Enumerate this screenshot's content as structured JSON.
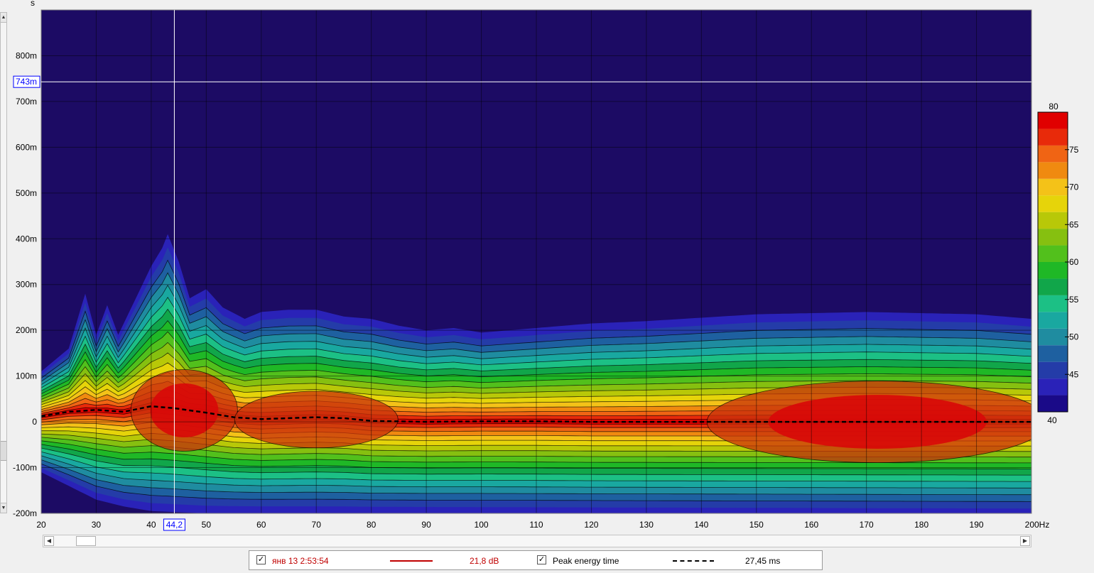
{
  "y_axis_unit": "s",
  "cursor": {
    "freq_label": "44,2",
    "time_label": "743m",
    "freq": 44.2,
    "time_ms": 743
  },
  "chart_data": {
    "type": "heatmap",
    "title": "",
    "x": {
      "min": 20,
      "max": 200,
      "unit": "Hz",
      "ticks": [
        20,
        30,
        40,
        50,
        60,
        70,
        80,
        90,
        100,
        110,
        120,
        130,
        140,
        150,
        160,
        170,
        180,
        190,
        200
      ],
      "tick_labels": [
        "20",
        "30",
        "40",
        "50",
        "60",
        "70",
        "80",
        "90",
        "100",
        "110",
        "120",
        "130",
        "140",
        "150",
        "160",
        "170",
        "180",
        "190",
        "200Hz"
      ]
    },
    "y": {
      "min_ms": -200,
      "max_ms": 900,
      "ticks_ms": [
        800,
        700,
        600,
        500,
        400,
        300,
        200,
        100,
        0,
        -100,
        -200
      ],
      "tick_labels": [
        "800m",
        "700m",
        "600m",
        "500m",
        "400m",
        "300m",
        "200m",
        "100m",
        "0",
        "-100m",
        "-200m"
      ]
    },
    "colorbar": {
      "min": 40,
      "max": 80,
      "step": 2.5,
      "labels": [
        "80",
        "75",
        "70",
        "65",
        "60",
        "55",
        "50",
        "45",
        "40"
      ],
      "colors": [
        "#1a0a88",
        "#2a22b8",
        "#243ca8",
        "#1e60a0",
        "#1f8ca0",
        "#19a8a0",
        "#1cc085",
        "#11a64a",
        "#1fb826",
        "#52c01c",
        "#86c010",
        "#b8c808",
        "#e6d40a",
        "#f4c218",
        "#f08a10",
        "#f06414",
        "#e82a0a",
        "#e00000"
      ]
    },
    "grid": true,
    "background_color": "#1c0b64",
    "peak_energy_time_ms": [
      [
        20,
        12
      ],
      [
        25,
        22
      ],
      [
        30,
        26
      ],
      [
        35,
        22
      ],
      [
        40,
        34
      ],
      [
        44,
        30
      ],
      [
        50,
        20
      ],
      [
        55,
        10
      ],
      [
        60,
        6
      ],
      [
        65,
        8
      ],
      [
        70,
        10
      ],
      [
        75,
        8
      ],
      [
        80,
        2
      ],
      [
        90,
        0
      ],
      [
        100,
        1
      ],
      [
        110,
        1
      ],
      [
        120,
        0
      ],
      [
        150,
        0
      ],
      [
        200,
        0
      ]
    ],
    "upper_edge_ms": [
      [
        20,
        110
      ],
      [
        25,
        160
      ],
      [
        28,
        280
      ],
      [
        30,
        190
      ],
      [
        32,
        255
      ],
      [
        34,
        190
      ],
      [
        38,
        290
      ],
      [
        40,
        340
      ],
      [
        42,
        380
      ],
      [
        43,
        410
      ],
      [
        45,
        350
      ],
      [
        47,
        270
      ],
      [
        50,
        290
      ],
      [
        53,
        250
      ],
      [
        57,
        225
      ],
      [
        60,
        240
      ],
      [
        65,
        245
      ],
      [
        70,
        245
      ],
      [
        75,
        230
      ],
      [
        80,
        225
      ],
      [
        85,
        210
      ],
      [
        90,
        200
      ],
      [
        95,
        205
      ],
      [
        100,
        195
      ],
      [
        110,
        205
      ],
      [
        120,
        215
      ],
      [
        130,
        220
      ],
      [
        150,
        235
      ],
      [
        170,
        240
      ],
      [
        190,
        235
      ],
      [
        200,
        225
      ]
    ],
    "lower_edge_ms": [
      [
        20,
        -110
      ],
      [
        25,
        -140
      ],
      [
        30,
        -170
      ],
      [
        35,
        -185
      ],
      [
        40,
        -195
      ],
      [
        50,
        -200
      ],
      [
        200,
        -205
      ]
    ],
    "hotspots": [
      {
        "freq": 46,
        "time_ms": 25,
        "level_db": 80
      },
      {
        "freq": 70,
        "time_ms": 5,
        "level_db": 75
      },
      {
        "freq": 172,
        "time_ms": 0,
        "level_db": 80
      }
    ]
  },
  "legend": {
    "series_timestamp": "янв 13 2:53:54",
    "series_value": "21,8 dB",
    "series_color": "#c00000",
    "peak_label": "Peak energy time",
    "peak_value": "27,45 ms"
  }
}
